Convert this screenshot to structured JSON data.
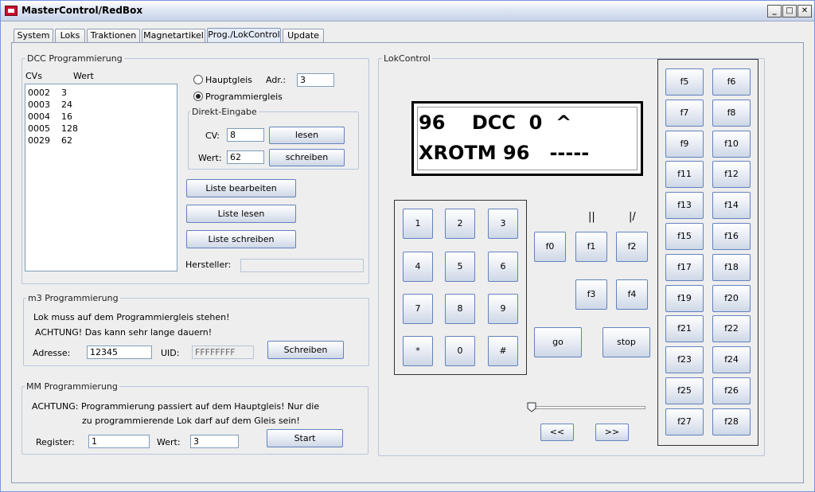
{
  "window": {
    "title": "MasterControl/RedBox"
  },
  "tabs": [
    "System",
    "Loks",
    "Traktionen",
    "Magnetartikel",
    "Prog./LokControl",
    "Update"
  ],
  "dcc": {
    "title": "DCC Programmierung",
    "col_cv": "CVs",
    "col_value": "Wert",
    "rows": [
      {
        "cv": "0002",
        "value": "3"
      },
      {
        "cv": "0003",
        "value": "24"
      },
      {
        "cv": "0004",
        "value": "16"
      },
      {
        "cv": "0005",
        "value": "128"
      },
      {
        "cv": "0029",
        "value": "62"
      }
    ],
    "radio_main": "Hauptgleis",
    "radio_prog": "Programmiergleis",
    "adr_label": "Adr.:",
    "adr_value": "3",
    "direct_title": "Direkt-Eingabe",
    "cv_label": "CV:",
    "cv_value": "8",
    "read_button": "lesen",
    "value_label": "Wert:",
    "value_value": "62",
    "write_button": "schreiben",
    "edit_list_button": "Liste bearbeiten",
    "read_list_button": "Liste lesen",
    "write_list_button": "Liste schreiben",
    "manufacturer_label": "Hersteller:",
    "manufacturer_value": ""
  },
  "m3": {
    "title": "m3 Programmierung",
    "note1": "Lok muss auf dem Programmiergleis stehen!",
    "note2": "ACHTUNG! Das kann sehr lange dauern!",
    "address_label": "Adresse:",
    "address_value": "12345",
    "uid_label": "UID:",
    "uid_value": "FFFFFFFF",
    "write_button": "Schreiben"
  },
  "mm": {
    "title": "MM Programmierung",
    "note1": "ACHTUNG: Programmierung passiert auf dem Hauptgleis! Nur die",
    "note2": "zu programmierende Lok darf auf dem Gleis sein!",
    "register_label": "Register:",
    "register_value": "1",
    "value_label": "Wert:",
    "value_value": "3",
    "start_button": "Start"
  },
  "lok": {
    "title": "LokControl",
    "display_line1": "96    DCC  0  ^",
    "display_line2": "XROTM 96   -----",
    "keys": [
      "1",
      "2",
      "3",
      "4",
      "5",
      "6",
      "7",
      "8",
      "9",
      "*",
      "0",
      "#"
    ],
    "pause_symbol": "||",
    "dir_symbol": "|/",
    "f0": "f0",
    "f1": "f1",
    "f2": "f2",
    "f3": "f3",
    "f4": "f4",
    "go": "go",
    "stop": "stop",
    "rewind": "<<",
    "forward": ">>",
    "speed": 0,
    "fkeys": [
      "f5",
      "f6",
      "f7",
      "f8",
      "f9",
      "f10",
      "f11",
      "f12",
      "f13",
      "f14",
      "f15",
      "f16",
      "f17",
      "f18",
      "f19",
      "f20",
      "f21",
      "f22",
      "f23",
      "f24",
      "f25",
      "f26",
      "f27",
      "f28"
    ]
  }
}
